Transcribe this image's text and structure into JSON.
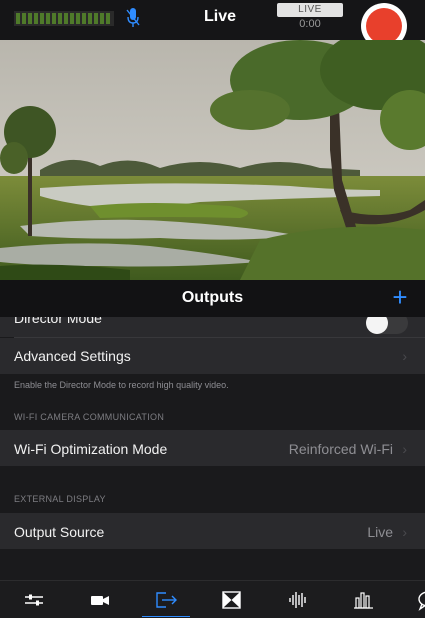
{
  "header": {
    "title": "Live",
    "live_label": "LIVE",
    "timer": "0:00"
  },
  "panel": {
    "title": "Outputs",
    "add_label": "+"
  },
  "settings": {
    "director_mode": {
      "label": "Director Mode",
      "on": false
    },
    "advanced_settings": {
      "label": "Advanced Settings"
    },
    "director_note": "Enable the Director Mode to record high quality video.",
    "wifi_section": "WI-FI CAMERA COMMUNICATION",
    "wifi_optimization": {
      "label": "Wi-Fi Optimization Mode",
      "value": "Reinforced Wi-Fi"
    },
    "external_section": "EXTERNAL DISPLAY",
    "output_source": {
      "label": "Output Source",
      "value": "Live"
    }
  },
  "tabs": [
    {
      "icon": "sliders-icon",
      "active": false
    },
    {
      "icon": "video-camera-icon",
      "active": false
    },
    {
      "icon": "output-icon",
      "active": true
    },
    {
      "icon": "transition-icon",
      "active": false
    },
    {
      "icon": "audio-waveform-icon",
      "active": false
    },
    {
      "icon": "stats-icon",
      "active": false
    },
    {
      "icon": "chat-icon",
      "active": false
    }
  ],
  "colors": {
    "accent": "#2f8cff",
    "record": "#e8402c",
    "row_background": "#2a2a2d"
  }
}
